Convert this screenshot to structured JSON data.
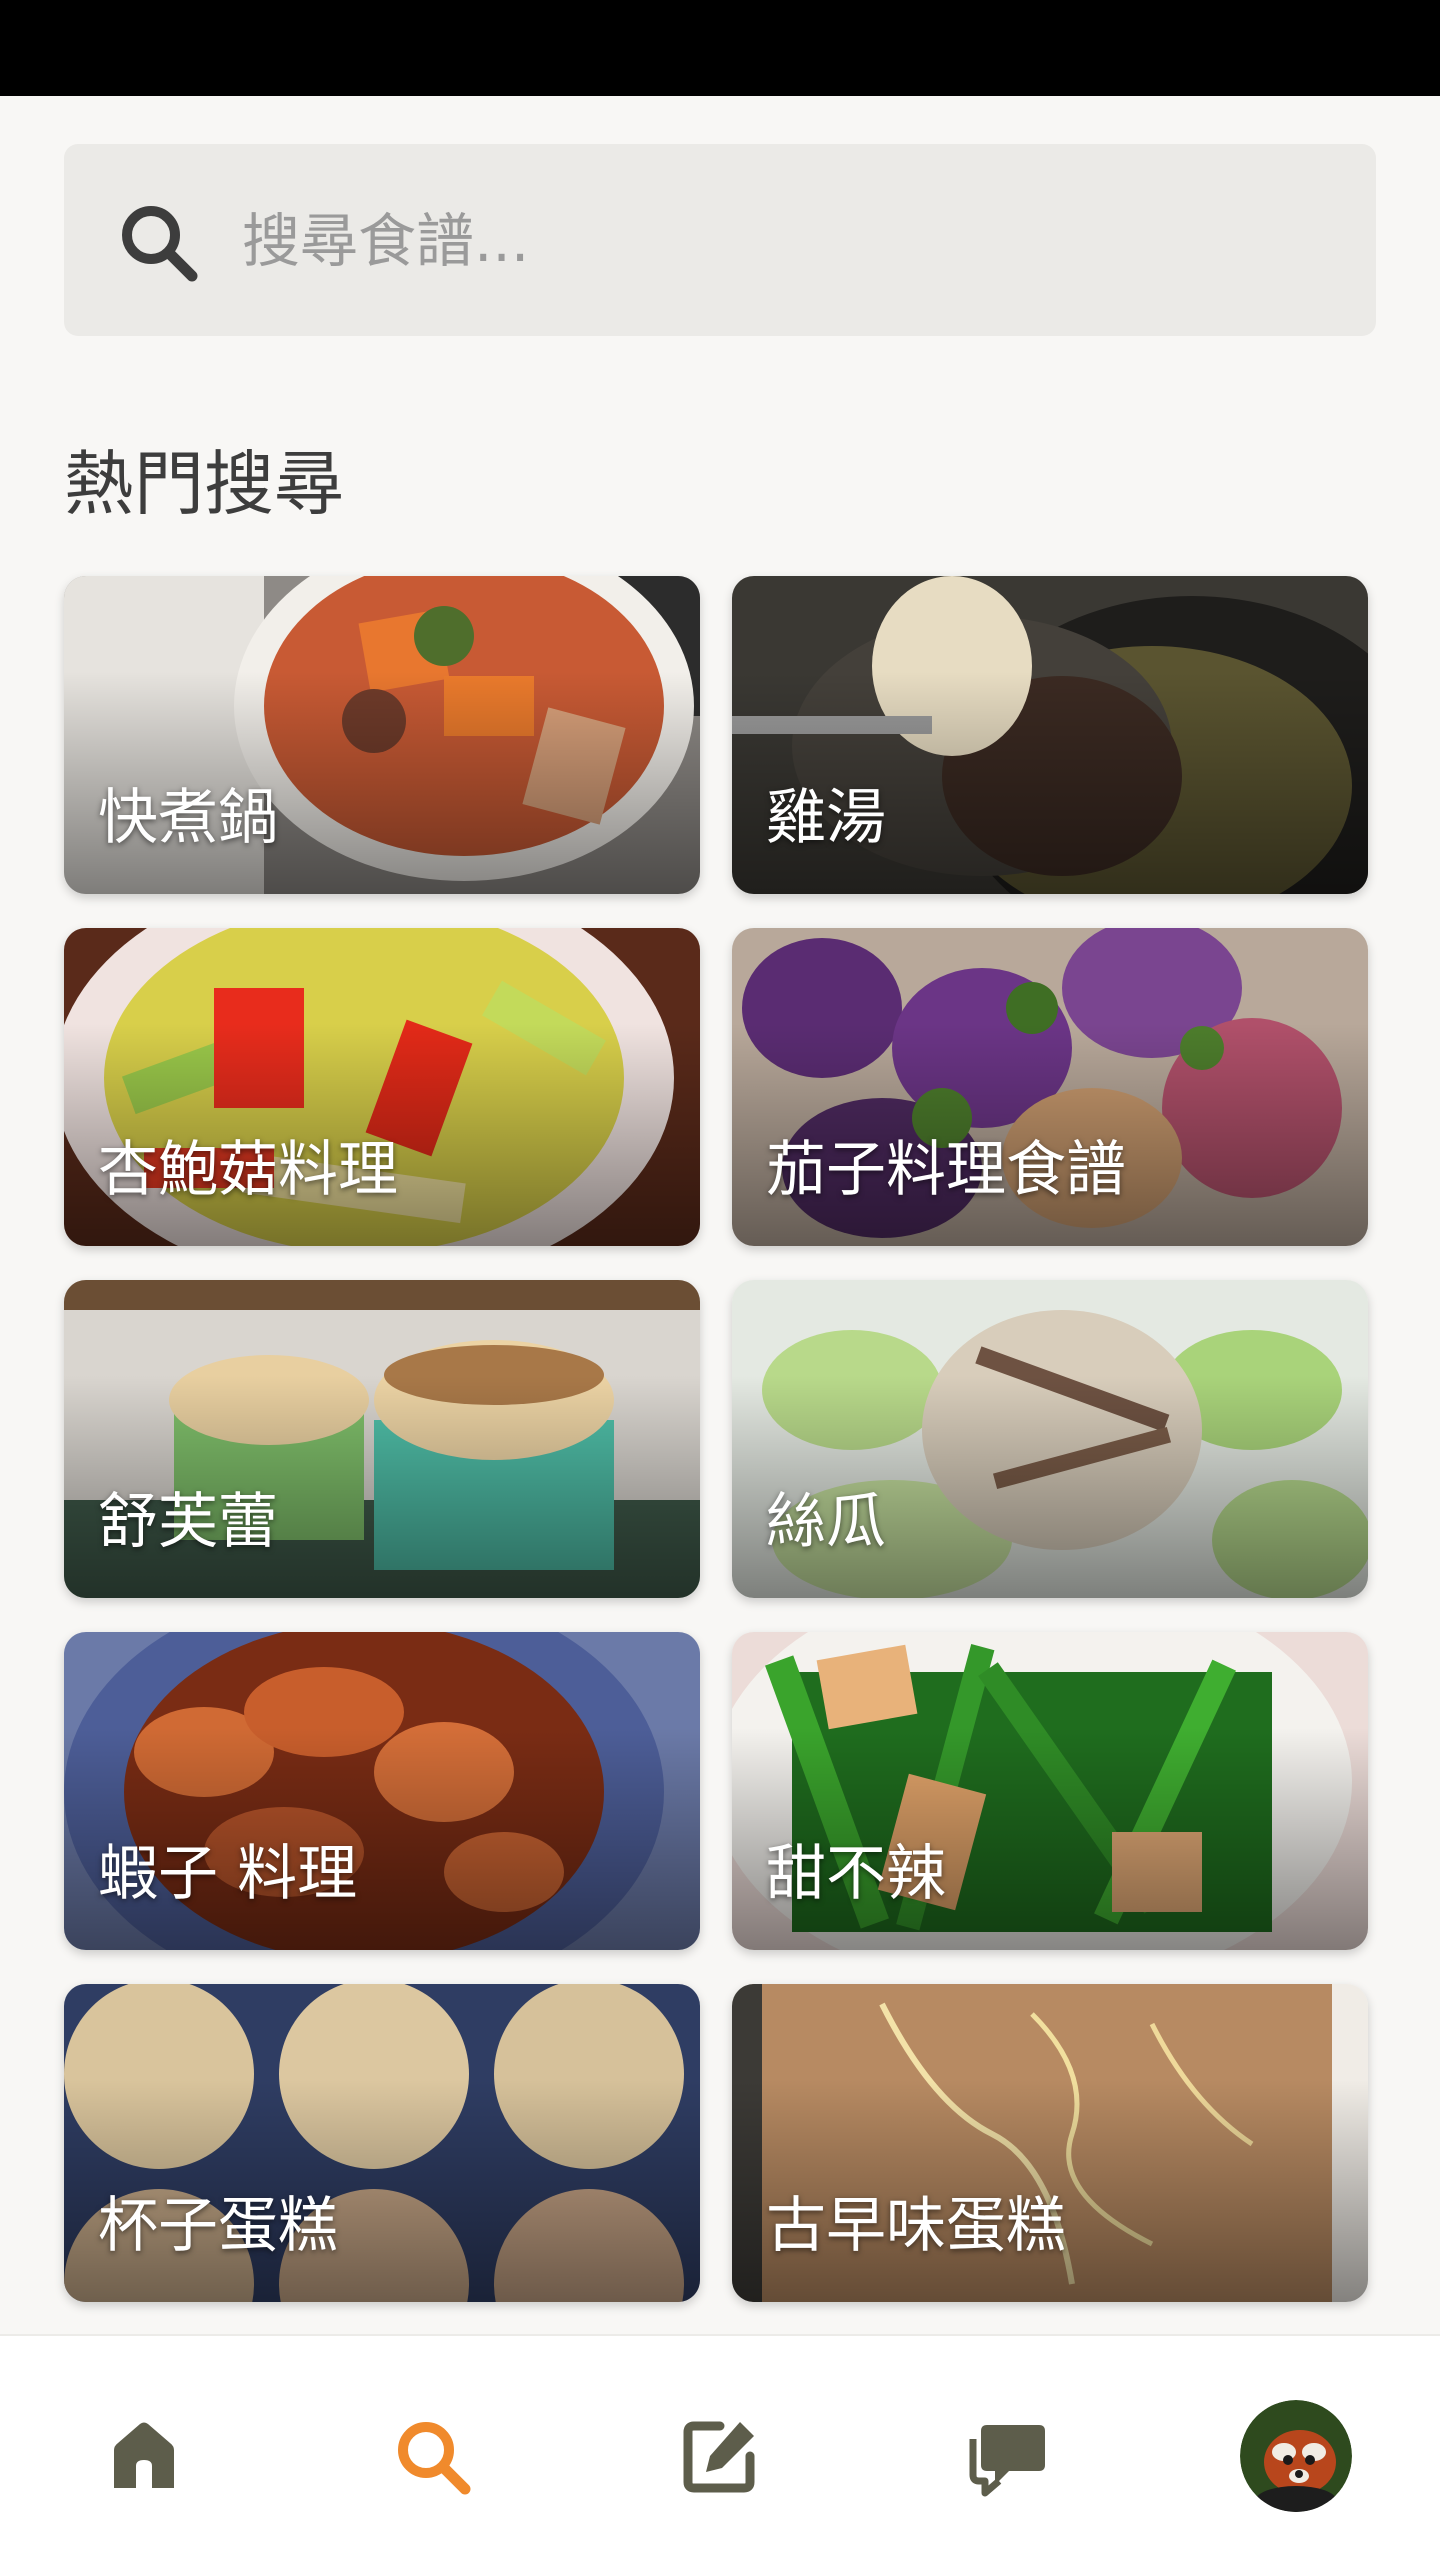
{
  "search": {
    "placeholder": "搜尋食譜..."
  },
  "section": {
    "title": "熱門搜尋"
  },
  "tiles": [
    {
      "label": "快煮鍋"
    },
    {
      "label": "雞湯"
    },
    {
      "label": "杏鮑菇料理"
    },
    {
      "label": "茄子料理食譜"
    },
    {
      "label": "舒芙蕾"
    },
    {
      "label": "絲瓜"
    },
    {
      "label": "蝦子 料理"
    },
    {
      "label": "甜不辣"
    },
    {
      "label": "杯子蛋糕"
    },
    {
      "label": "古早味蛋糕"
    }
  ],
  "bottom_nav": {
    "items": [
      {
        "icon": "home-icon"
      },
      {
        "icon": "search-icon"
      },
      {
        "icon": "edit-icon"
      },
      {
        "icon": "chat-icon"
      },
      {
        "icon": "profile-avatar"
      }
    ],
    "active": "search-icon"
  },
  "colors": {
    "accent": "#f08a2c",
    "nav_icon": "#5d5d4b",
    "background": "#f8f7f5",
    "search_bg": "#ebeae7"
  }
}
